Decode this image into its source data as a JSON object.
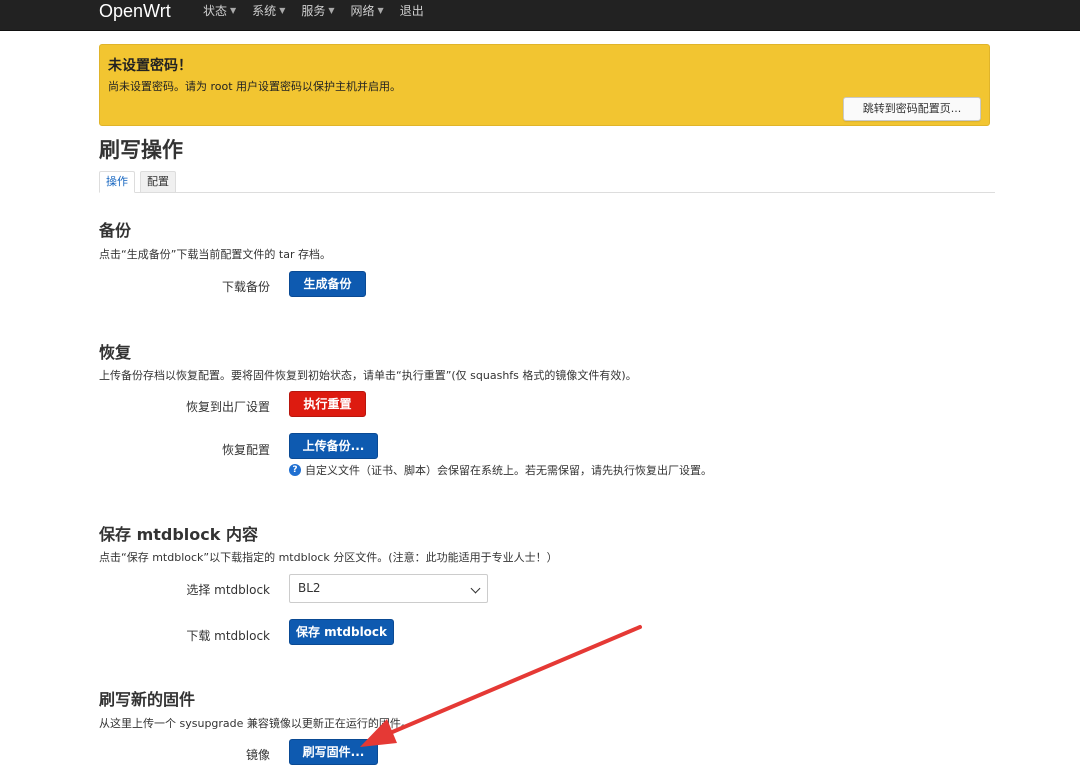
{
  "navbar": {
    "brand": "OpenWrt",
    "menu": [
      "状态",
      "系统",
      "服务",
      "网络",
      "退出"
    ]
  },
  "alert": {
    "title": "未设置密码！",
    "text": "尚未设置密码。请为 root 用户设置密码以保护主机并启用。",
    "button": "跳转到密码配置页..."
  },
  "page": {
    "title": "刷写操作",
    "tabs": [
      "操作",
      "配置"
    ]
  },
  "backup": {
    "title": "备份",
    "desc": "点击“生成备份”下载当前配置文件的 tar 存档。",
    "label": "下载备份",
    "button": "生成备份"
  },
  "restore": {
    "title": "恢复",
    "desc": "上传备份存档以恢复配置。要将固件恢复到初始状态，请单击“执行重置”(仅 squashfs 格式的镜像文件有效)。",
    "reset_label": "恢复到出厂设置",
    "reset_button": "执行重置",
    "upload_label": "恢复配置",
    "upload_button": "上传备份...",
    "help": "自定义文件（证书、脚本）会保留在系统上。若无需保留，请先执行恢复出厂设置。"
  },
  "mtd": {
    "title": "保存 mtdblock 内容",
    "desc": "点击“保存 mtdblock”以下载指定的 mtdblock 分区文件。(注意：此功能适用于专业人士！）",
    "select_label": "选择 mtdblock",
    "select_value": "BL2",
    "download_label": "下载 mtdblock",
    "download_button": "保存 mtdblock"
  },
  "flash": {
    "title": "刷写新的固件",
    "desc": "从这里上传一个 sysupgrade 兼容镜像以更新正在运行的固件。",
    "label": "镜像",
    "button": "刷写固件..."
  },
  "colors": {
    "navbar": "#222222",
    "alert": "#f2c531",
    "primary_button": "#0e5ab0",
    "danger_button": "#dd1b10",
    "annotation_arrow": "#e53935"
  }
}
